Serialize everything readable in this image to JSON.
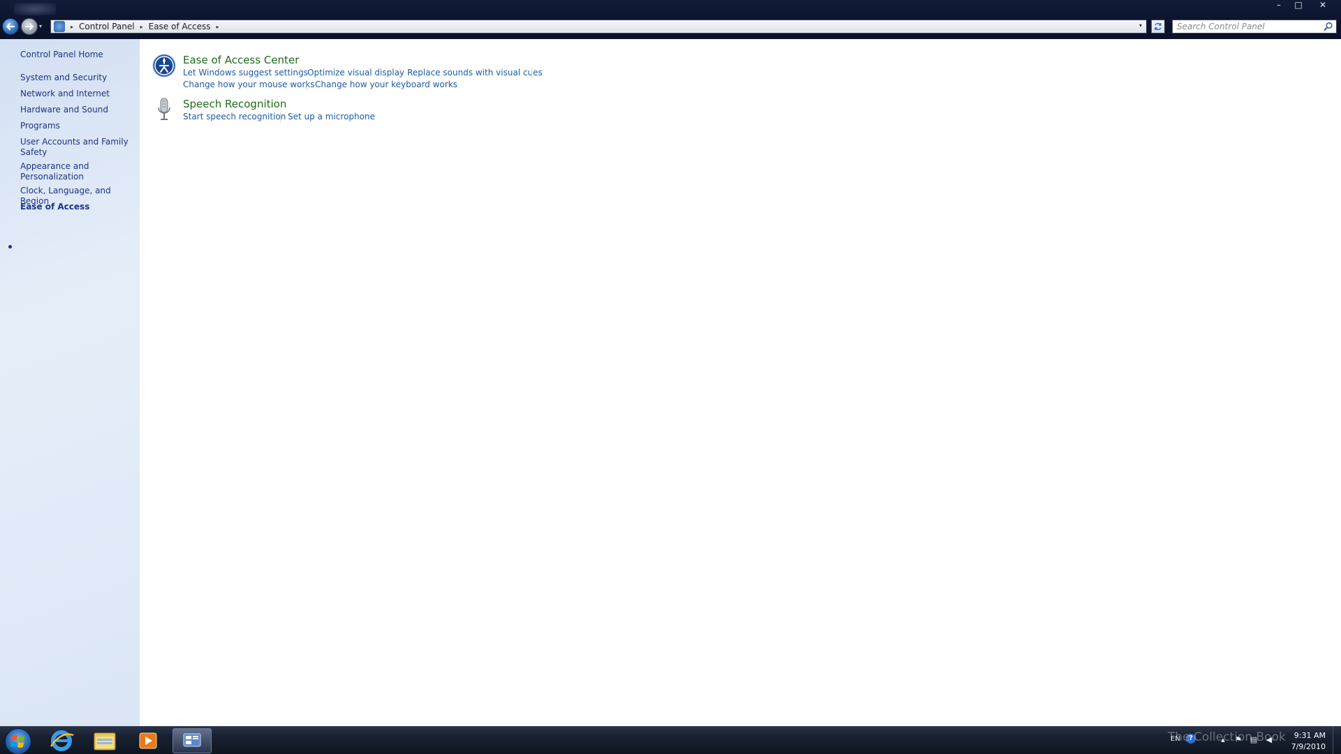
{
  "window": {
    "minimize_glyph": "–",
    "maximize_glyph": "□",
    "close_glyph": "✕"
  },
  "address": {
    "crumbs": [
      "Control Panel",
      "Ease of Access"
    ],
    "separator_glyph": "▸",
    "dropdown_glyph": "▾"
  },
  "search": {
    "placeholder": "Search Control Panel"
  },
  "sidebar": {
    "items": [
      {
        "label": "Control Panel Home"
      },
      {
        "label": "System and Security"
      },
      {
        "label": "Network and Internet"
      },
      {
        "label": "Hardware and Sound"
      },
      {
        "label": "Programs"
      },
      {
        "label": "User Accounts and Family Safety"
      },
      {
        "label": "Appearance and Personalization"
      },
      {
        "label": "Clock, Language, and Region"
      },
      {
        "label": "Ease of Access",
        "current": true
      }
    ]
  },
  "categories": [
    {
      "title": "Ease of Access Center",
      "icon": "ease-of-access-icon",
      "links": [
        "Let Windows suggest settings",
        "Optimize visual display",
        "Replace sounds with visual cues",
        "Change how your mouse works",
        "Change how your keyboard works"
      ]
    },
    {
      "title": "Speech Recognition",
      "icon": "microphone-icon",
      "links": [
        "Start speech recognition",
        "Set up a microphone"
      ]
    }
  ],
  "taskbar": {
    "items": [
      "start-orb",
      "internet-explorer-icon",
      "windows-explorer-icon",
      "media-player-icon",
      "control-panel-icon"
    ],
    "tray": {
      "language": "EN",
      "help_glyph": "?",
      "time": "9:31 AM",
      "date": "7/9/2010"
    }
  },
  "watermark": "The Collection Book",
  "colors": {
    "link": "#1e5aa8",
    "category_title": "#1e6a1e",
    "sidebar_link": "#1e3287"
  }
}
